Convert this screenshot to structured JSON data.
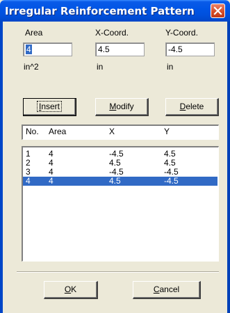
{
  "window": {
    "title": "Irregular Reinforcement Pattern"
  },
  "fields": {
    "area": {
      "label": "Area",
      "value": "4",
      "unit": "in^2"
    },
    "x": {
      "label": "X-Coord.",
      "value": "4.5",
      "unit": "in"
    },
    "y": {
      "label": "Y-Coord.",
      "value": "-4.5",
      "unit": "in"
    }
  },
  "buttons": {
    "insert": {
      "mnemonic": "I",
      "rest": "nsert"
    },
    "modify": {
      "mnemonic": "M",
      "rest": "odify"
    },
    "delete": {
      "mnemonic": "D",
      "rest": "elete"
    },
    "ok": {
      "mnemonic": "O",
      "rest": "K"
    },
    "cancel": {
      "mnemonic": "C",
      "rest": "ancel"
    }
  },
  "table": {
    "columns": [
      "No.",
      "Area",
      "X",
      "Y"
    ],
    "rows": [
      {
        "no": "1",
        "area": "4",
        "x": "-4.5",
        "y": "4.5"
      },
      {
        "no": "2",
        "area": "4",
        "x": "4.5",
        "y": "4.5"
      },
      {
        "no": "3",
        "area": "4",
        "x": "-4.5",
        "y": "-4.5"
      },
      {
        "no": "4",
        "area": "4",
        "x": "4.5",
        "y": "-4.5"
      }
    ],
    "selected_row": 3
  },
  "icons": {
    "close": "close-icon"
  },
  "colors": {
    "titlebar": "#0055e5",
    "selection": "#316ac5",
    "face": "#ece9d8",
    "close": "#d54b25"
  }
}
